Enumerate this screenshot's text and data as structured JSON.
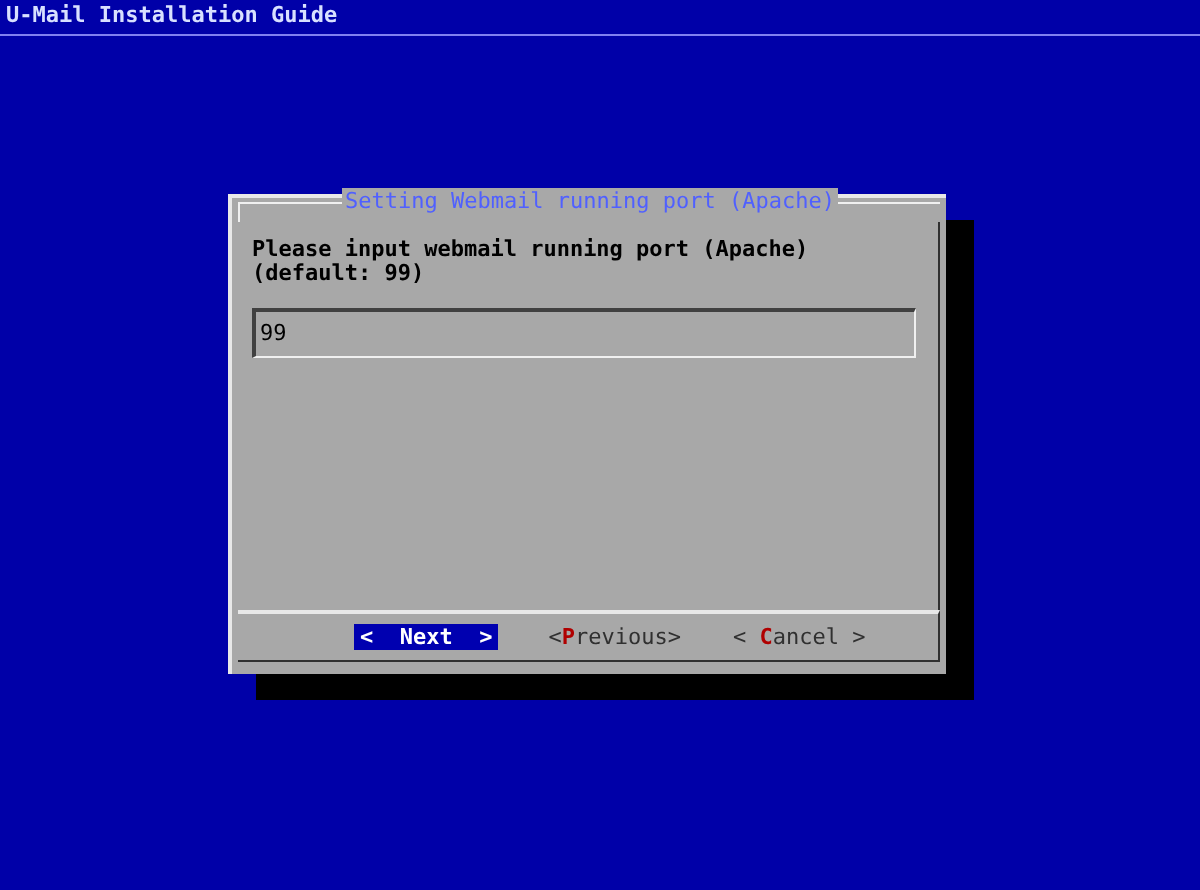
{
  "screen_title": "U-Mail Installation Guide",
  "dialog": {
    "title": "Setting Webmail running port (Apache)",
    "prompt": "Please input webmail running port (Apache)\n(default: 99)",
    "input_value": "99",
    "buttons": [
      {
        "left": "<",
        "hotkey": "N",
        "rest": "ext",
        "right": ">",
        "selected": true
      },
      {
        "left": "<",
        "hotkey": "P",
        "rest": "revious",
        "right": ">",
        "selected": false
      },
      {
        "left": "<",
        "hotkey": "C",
        "rest": "ancel",
        "right": ">",
        "selected": false
      }
    ]
  }
}
